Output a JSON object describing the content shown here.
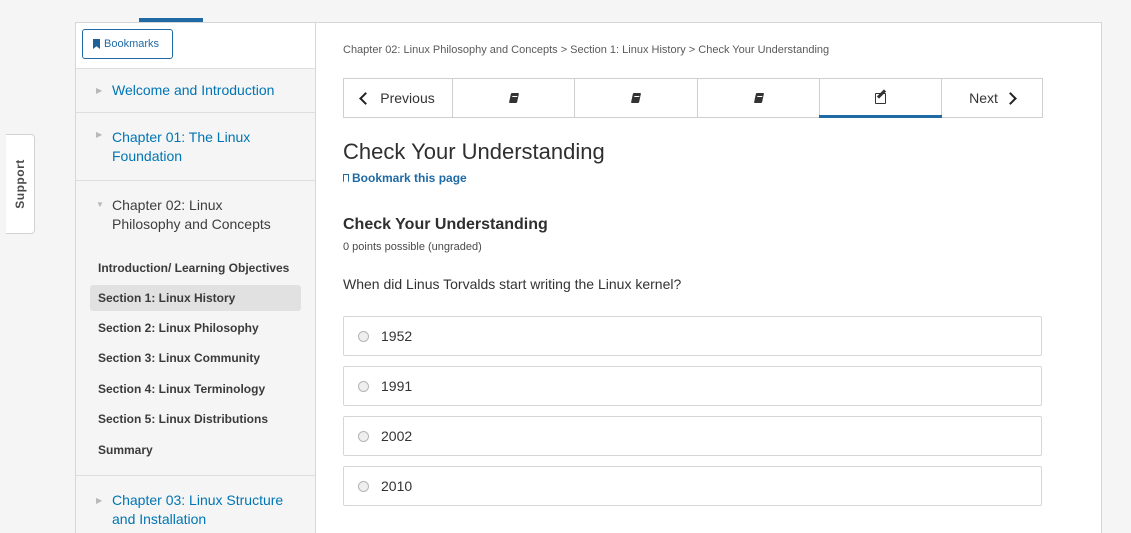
{
  "support": {
    "label": "Support"
  },
  "sidebar": {
    "bookmarks_label": "Bookmarks",
    "sections": [
      {
        "title": "Welcome and Introduction"
      },
      {
        "title": "Chapter 01: The Linux Foundation"
      },
      {
        "title": "Chapter 02: Linux Philosophy and Concepts"
      },
      {
        "title": "Chapter 03: Linux Structure and Installation"
      }
    ],
    "subsections": [
      {
        "label": "Introduction/ Learning Objectives"
      },
      {
        "label": "Section 1: Linux History"
      },
      {
        "label": "Section 2: Linux Philosophy"
      },
      {
        "label": "Section 3: Linux Community"
      },
      {
        "label": "Section 4: Linux Terminology"
      },
      {
        "label": "Section 5: Linux Distributions"
      },
      {
        "label": "Summary"
      }
    ]
  },
  "breadcrumb": "Chapter 02: Linux Philosophy and Concepts > Section 1: Linux History > Check Your Understanding",
  "seqnav": {
    "previous": "Previous",
    "next": "Next"
  },
  "page": {
    "title": "Check Your Understanding",
    "bookmark_link": "Bookmark this page"
  },
  "problem": {
    "title": "Check Your Understanding",
    "points": "0 points possible (ungraded)",
    "question": "When did Linus Torvalds start writing the Linux kernel?",
    "choices": [
      "1952",
      "1991",
      "2002",
      "2010"
    ]
  },
  "colors": {
    "accent": "#1f6aa5",
    "link": "#0075b4"
  }
}
